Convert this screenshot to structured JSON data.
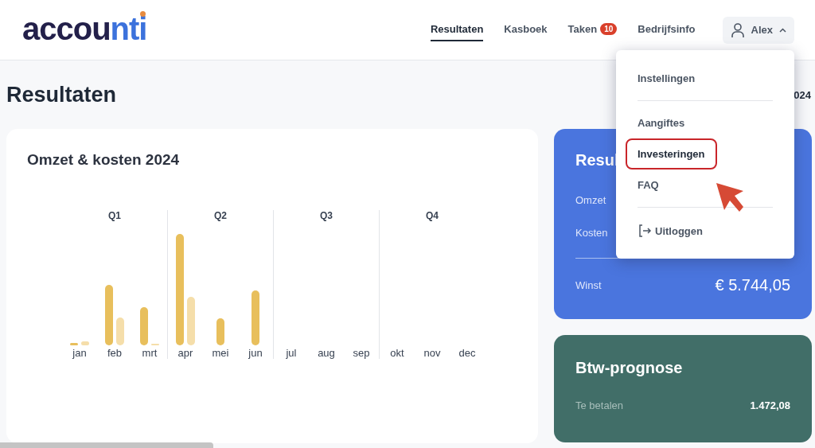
{
  "header": {
    "logo": {
      "dark": "accou",
      "blue": "nti"
    },
    "nav": [
      {
        "label": "Resultaten",
        "selected": true
      },
      {
        "label": "Kasboek",
        "selected": false
      },
      {
        "label": "Taken",
        "selected": false,
        "badge": "10"
      },
      {
        "label": "Bedrijfsinfo",
        "selected": false
      }
    ],
    "user": {
      "name": "Alex",
      "expanded": true
    }
  },
  "page": {
    "title": "Resultaten",
    "period": "024"
  },
  "chart_card": {
    "title": "Omzet & kosten 2024",
    "quarters": [
      "Q1",
      "Q2",
      "Q3",
      "Q4"
    ],
    "months": [
      "jan",
      "feb",
      "mrt",
      "apr",
      "mei",
      "jun",
      "jul",
      "aug",
      "sep",
      "okt",
      "nov",
      "dec"
    ]
  },
  "result_card": {
    "title": "Resul",
    "rows": [
      {
        "label": "Omzet"
      },
      {
        "label": "Kosten"
      }
    ],
    "total": {
      "label": "Winst",
      "value": "€ 5.744,05"
    }
  },
  "vat_card": {
    "title": "Btw-prognose",
    "row": {
      "label": "Te betalen",
      "value": "1.472,08"
    }
  },
  "user_menu": [
    {
      "kind": "item",
      "label": "Instellingen",
      "highlighted": false
    },
    {
      "kind": "divider"
    },
    {
      "kind": "item",
      "label": "Aangiftes",
      "highlighted": false
    },
    {
      "kind": "item",
      "label": "Investeringen",
      "highlighted": true
    },
    {
      "kind": "item",
      "label": "FAQ",
      "highlighted": false
    },
    {
      "kind": "divider"
    },
    {
      "kind": "logout",
      "label": "Uitloggen",
      "highlighted": false
    }
  ]
}
